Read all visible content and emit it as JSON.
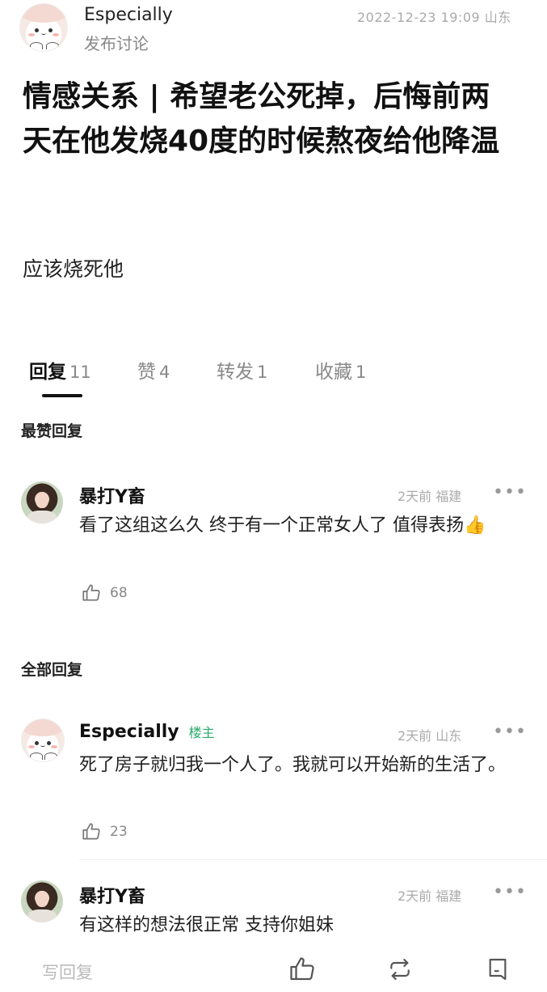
{
  "post": {
    "author": "Especially",
    "action": "发布讨论",
    "timestamp": "2022-12-23 19:09",
    "location": "山东",
    "title": "情感关系 | 希望老公死掉，后悔前两天在他发烧40度的时候熬夜给他降温",
    "body": "应该烧死他"
  },
  "tabs": [
    {
      "label": "回复",
      "count": "11",
      "active": true
    },
    {
      "label": "赞",
      "count": "4",
      "active": false
    },
    {
      "label": "转发",
      "count": "1",
      "active": false
    },
    {
      "label": "收藏",
      "count": "1",
      "active": false
    }
  ],
  "sections": {
    "top": "最赞回复",
    "all": "全部回复"
  },
  "top_replies": [
    {
      "name": "暴打Y畜",
      "time": "2天前",
      "location": "福建",
      "text": "看了这组这么久 终于有一个正常女人了 值得表扬👍",
      "likes": "68",
      "avatar_icon": "portrait-avatar-icon"
    }
  ],
  "all_replies": [
    {
      "name": "Especially",
      "badge": "楼主",
      "time": "2天前",
      "location": "山东",
      "text": "死了房子就归我一个人了。我就可以开始新的生活了。",
      "likes": "23",
      "avatar_icon": "seal-avatar-icon"
    },
    {
      "name": "暴打Y畜",
      "time": "2天前",
      "location": "福建",
      "text": "有这样的想法很正常 支持你姐妹",
      "avatar_icon": "portrait-avatar-icon"
    }
  ],
  "more_symbol": "•••",
  "bottom_bar": {
    "write_placeholder": "写回复",
    "icons": [
      "thumbs-up-icon",
      "repost-icon",
      "bookmark-icon"
    ]
  },
  "colors": {
    "owner_badge": "#2aa86b",
    "muted": "#aaaaaa",
    "text": "#111111"
  }
}
